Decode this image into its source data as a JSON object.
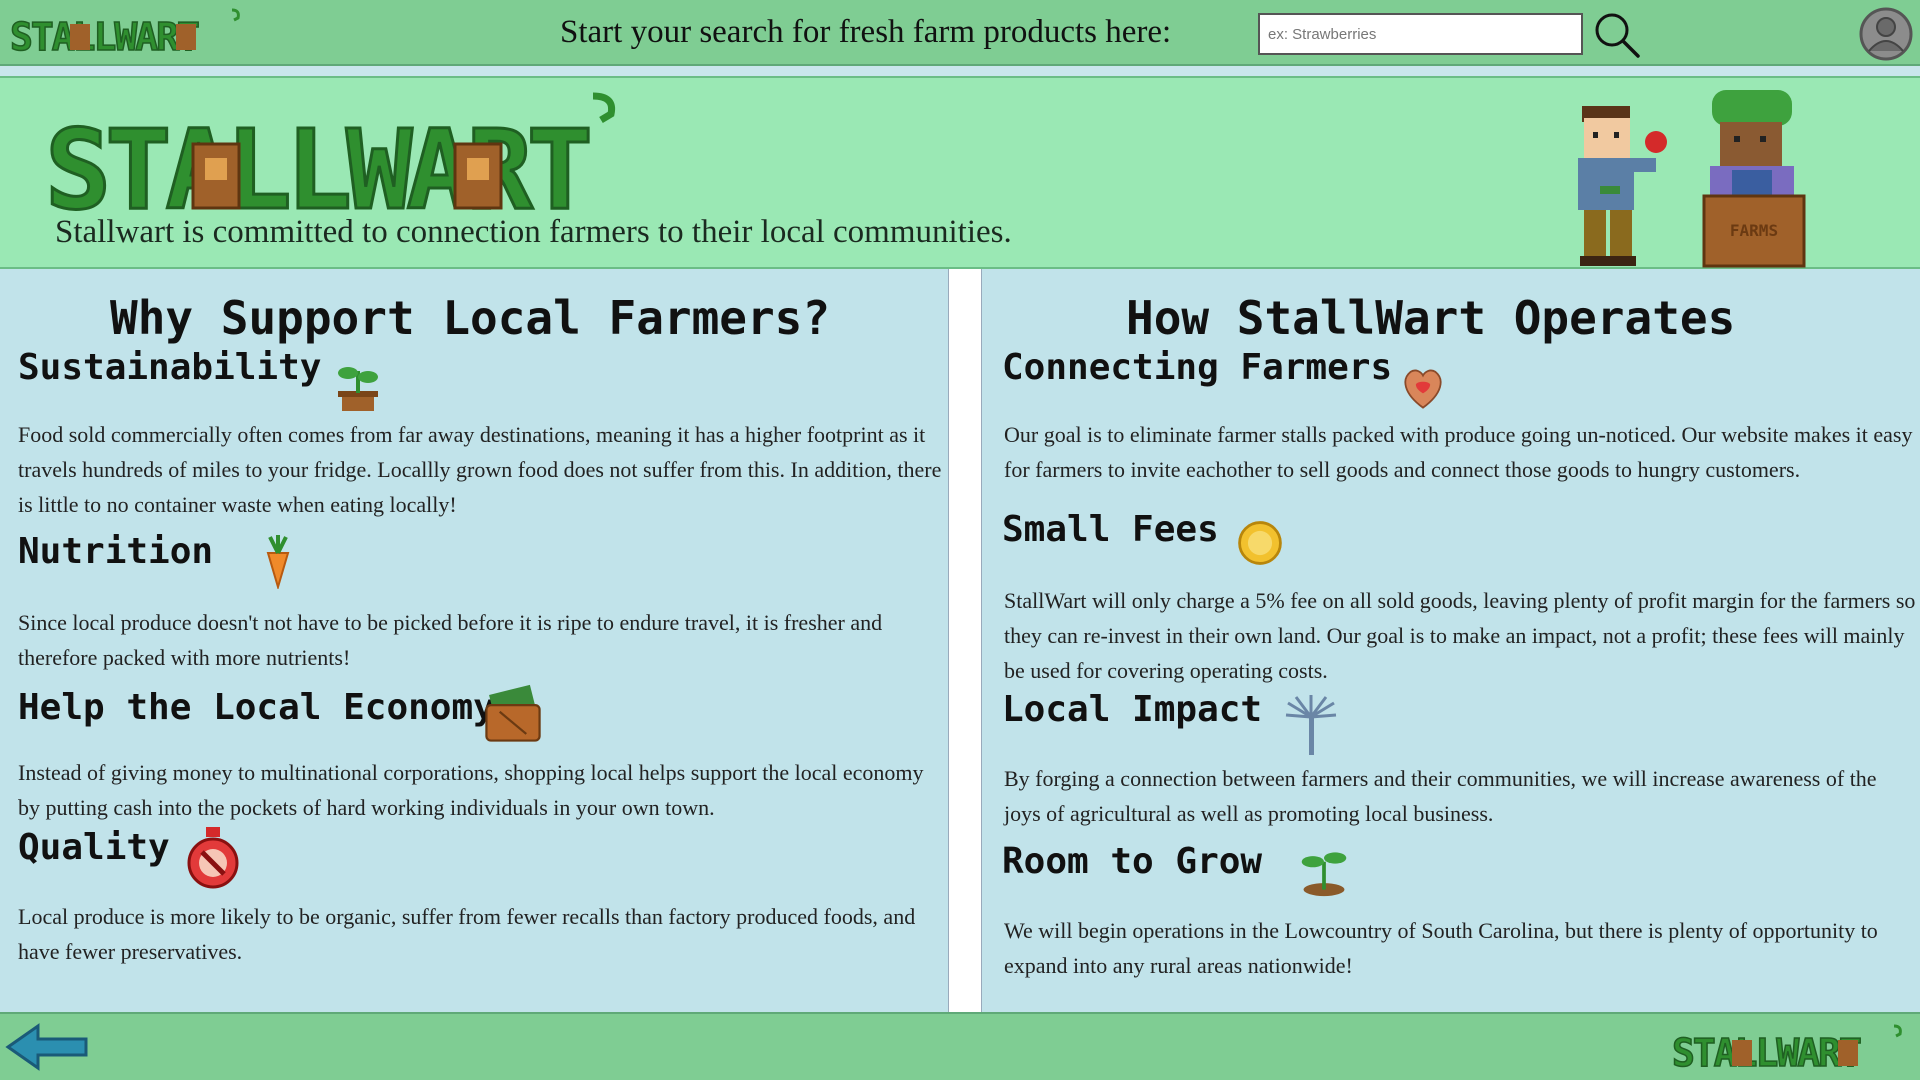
{
  "header": {
    "logo_text": "STALLWART",
    "search_prompt": "Start your search for fresh farm products here:",
    "search_placeholder": "ex: Strawberries",
    "search_icon": "search-icon",
    "profile_icon": "user-avatar-icon"
  },
  "hero": {
    "logo_text": "STALLWART",
    "tagline": "Stallwart is committed to connection farmers to their local communities.",
    "crate_label": "FARMS"
  },
  "left_column": {
    "title": "Why Support Local Farmers?",
    "sections": [
      {
        "heading": "Sustainability",
        "icon": "potted-plant-icon",
        "body": "Food sold commercially often comes from far away destinations, meaning it has a higher footprint as it travels hundreds of miles to your fridge. Locallly grown food does not suffer from this. In addition, there is little to no container waste when eating locally!"
      },
      {
        "heading": "Nutrition",
        "icon": "carrot-icon",
        "body": "Since local produce doesn't not have to be picked before it is ripe to endure travel, it is fresher and therefore packed with more nutrients!"
      },
      {
        "heading": "Help the Local Economy",
        "icon": "wallet-icon",
        "body": "Instead of giving money to multinational corporations, shopping local helps support the local economy by putting cash into the pockets of hard working individuals in your own town."
      },
      {
        "heading": "Quality",
        "icon": "no-chemicals-icon",
        "body": "Local produce is more likely to be organic, suffer from fewer recalls than factory produced foods, and have fewer preservatives."
      }
    ]
  },
  "right_column": {
    "title": "How StallWart Operates",
    "sections": [
      {
        "heading": "Connecting Farmers",
        "icon": "handshake-heart-icon",
        "body": "Our goal is to eliminate farmer stalls packed with produce going un-noticed. Our website makes it easy for farmers to invite eachother to sell goods and connect those goods to hungry customers."
      },
      {
        "heading": "Small Fees",
        "icon": "gold-coin-icon",
        "body": "StallWart will only charge a 5% fee on all sold goods, leaving plenty of profit margin for the farmers so they can re-invest in their own land. Our goal is to make an impact, not a profit; these fees will mainly be used for covering operating costs."
      },
      {
        "heading": "Local Impact",
        "icon": "palmetto-tree-icon",
        "body": "By forging a connection between farmers and their communities, we will increase awareness of the joys of agricultural as well as promoting local business."
      },
      {
        "heading": "Room to Grow",
        "icon": "sprout-icon",
        "body": "We will begin operations in the Lowcountry of South Carolina, but there is plenty of opportunity to expand into any rural areas nationwide!"
      }
    ]
  },
  "footer": {
    "back_icon": "back-arrow-icon",
    "logo_text": "STALLWART"
  },
  "colors": {
    "bar_green": "#7fcd93",
    "hero_green": "#9ae8b4",
    "panel_blue": "#c1e3ea",
    "logo_green": "#2f8f2f",
    "logo_dark": "#1f6b22",
    "wood_brown": "#a0612a"
  }
}
